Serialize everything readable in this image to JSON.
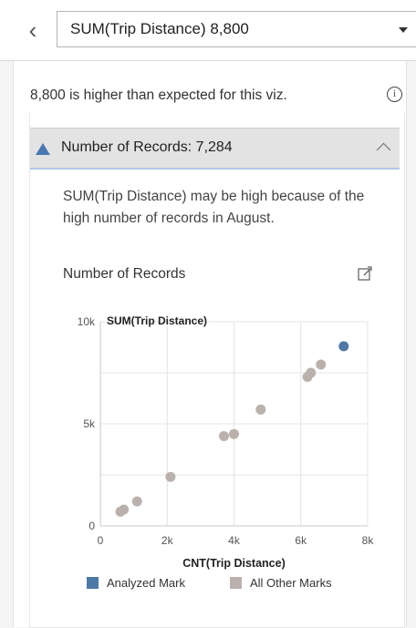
{
  "header": {
    "back_icon": "chevron-left-icon",
    "measure_value": "SUM(Trip Distance)  8,800"
  },
  "panel": {
    "message": "8,800 is higher than expected for this viz.",
    "info_icon": "i",
    "accordion_label": "Number of Records: 7,284",
    "explanation": "SUM(Trip Distance) may be high because of the high number of records in August.",
    "chart_title": "Number of Records"
  },
  "chart_data": {
    "type": "scatter",
    "title": "Number of Records",
    "xlabel": "CNT(Trip Distance)",
    "ylabel": "SUM(Trip Distance)",
    "xlim": [
      0,
      8000
    ],
    "ylim": [
      0,
      10000
    ],
    "x_ticks": [
      0,
      2000,
      4000,
      6000,
      8000
    ],
    "x_tick_labels": [
      "0",
      "2k",
      "4k",
      "6k",
      "8k"
    ],
    "y_ticks": [
      0,
      5000,
      10000
    ],
    "y_tick_labels": [
      "0",
      "5k",
      "10k"
    ],
    "grid": true,
    "legend": "bottom",
    "series": [
      {
        "name": "Analyzed Mark",
        "color": "#4e79a7",
        "points": [
          [
            7284,
            8800
          ]
        ]
      },
      {
        "name": "All Other Marks",
        "color": "#bab0ac",
        "points": [
          [
            600,
            700
          ],
          [
            700,
            800
          ],
          [
            1100,
            1200
          ],
          [
            2100,
            2400
          ],
          [
            3700,
            4400
          ],
          [
            4000,
            4500
          ],
          [
            4800,
            5700
          ],
          [
            6200,
            7300
          ],
          [
            6300,
            7500
          ],
          [
            6600,
            7900
          ]
        ]
      }
    ]
  }
}
